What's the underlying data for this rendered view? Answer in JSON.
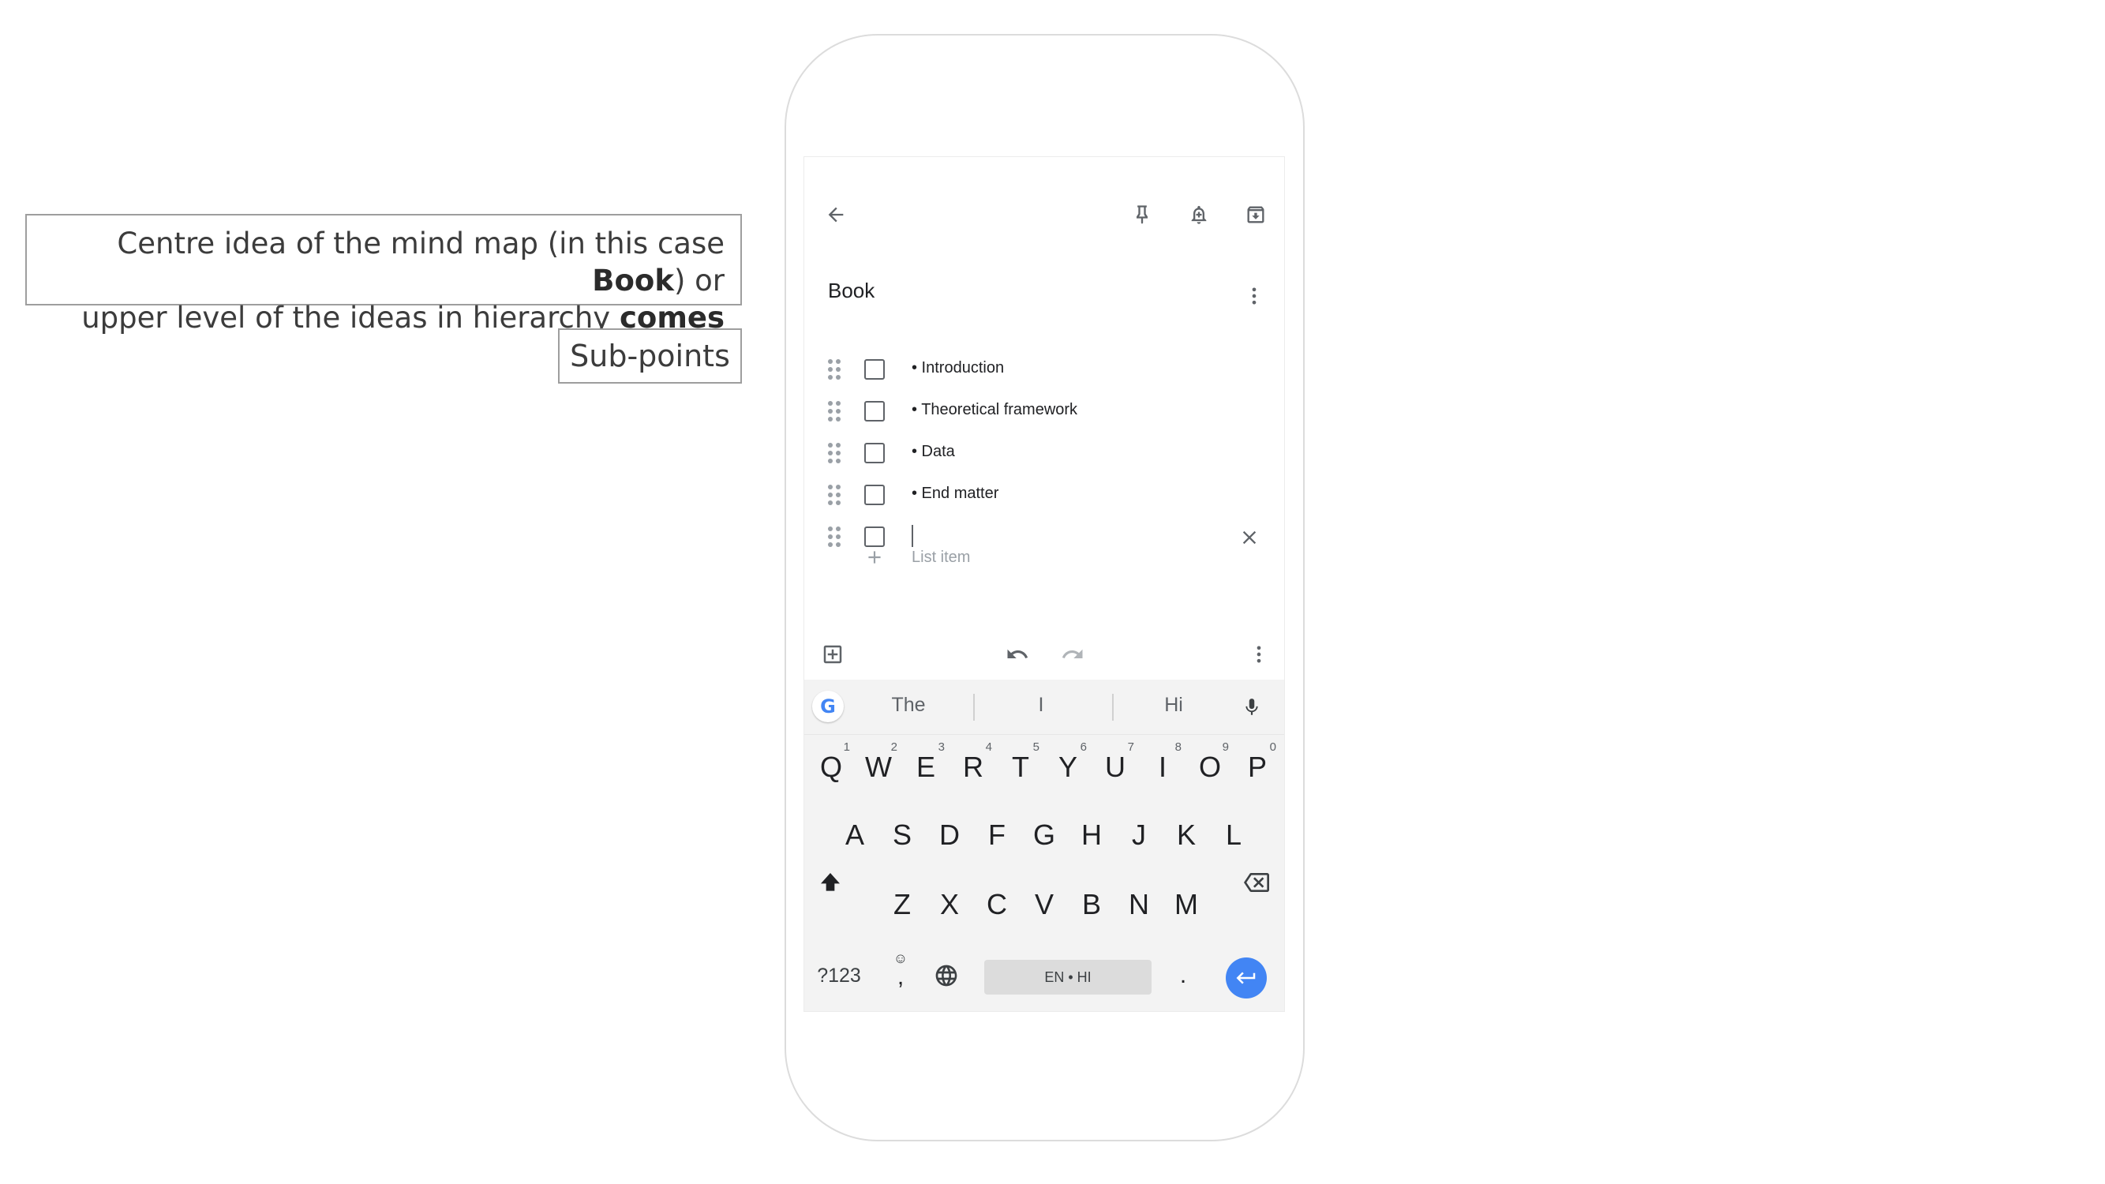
{
  "callouts": {
    "main": {
      "part1": "Centre idea of the mind map (in this case ",
      "bold1": "Book",
      "part2": ") or",
      "part3": "upper level of the ideas in hierarchy ",
      "bold2": "comes up"
    },
    "sub": "Sub-points"
  },
  "toolbar": {
    "back_icon": "arrow-back-icon",
    "pin_icon": "pin-icon",
    "reminder_icon": "reminder-bell-icon",
    "archive_icon": "archive-icon"
  },
  "note": {
    "title": "Book",
    "items": [
      "• Introduction",
      "• Theoretical framework",
      "• Data",
      "• End matter"
    ],
    "add_placeholder": "List item"
  },
  "bottom_toolbar": {
    "add_box_icon": "add-box-icon",
    "undo_icon": "undo-icon",
    "redo_icon": "redo-icon",
    "more_icon": "more-vert-icon"
  },
  "keyboard": {
    "google_logo": "G",
    "suggestions": [
      "The",
      "I",
      "Hi"
    ],
    "row1": [
      {
        "key": "Q",
        "num": "1"
      },
      {
        "key": "W",
        "num": "2"
      },
      {
        "key": "E",
        "num": "3"
      },
      {
        "key": "R",
        "num": "4"
      },
      {
        "key": "T",
        "num": "5"
      },
      {
        "key": "Y",
        "num": "6"
      },
      {
        "key": "U",
        "num": "7"
      },
      {
        "key": "I",
        "num": "8"
      },
      {
        "key": "O",
        "num": "9"
      },
      {
        "key": "P",
        "num": "0"
      }
    ],
    "row2": [
      "A",
      "S",
      "D",
      "F",
      "G",
      "H",
      "J",
      "K",
      "L"
    ],
    "row3": [
      "Z",
      "X",
      "C",
      "V",
      "B",
      "N",
      "M"
    ],
    "symbols_label": "?123",
    "emoji_glyph": "☺",
    "comma": ",",
    "space_label": "EN • HI",
    "period": "."
  },
  "colors": {
    "accent": "#4285f4",
    "icon": "#5f6368",
    "keyboard_bg": "#f3f3f3"
  }
}
